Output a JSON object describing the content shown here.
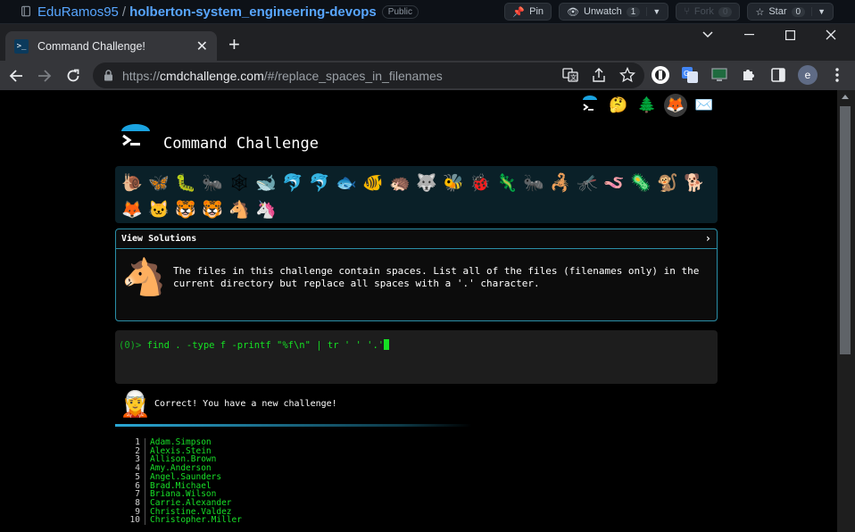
{
  "github": {
    "owner": "EduRamos95",
    "separator": "/",
    "repo": "holberton-system_engineering-devops",
    "visibility": "Public",
    "buttons": [
      {
        "label": "Pin",
        "icon": "pin-icon"
      },
      {
        "label": "Unwatch",
        "count": "1",
        "icon": "eye-icon"
      },
      {
        "label": "Fork",
        "count": "0",
        "icon": "fork-icon"
      },
      {
        "label": "Star",
        "count": "0",
        "icon": "star-icon"
      }
    ]
  },
  "browser": {
    "tab_title": "Command Challenge!",
    "url_scheme": "https://",
    "url_host": "cmdchallenge.com",
    "url_rest": "/#/replace_spaces_in_filenames",
    "profile_initial": "e"
  },
  "page": {
    "site_title": "Command Challenge",
    "level_icons": [
      "🐌",
      "🦋",
      "🐛",
      "🐜",
      "🕸",
      "🐋",
      "🐬",
      "🐬",
      "🐟",
      "🐠",
      "🦔",
      "🐺",
      "🐝",
      "🐞",
      "🦎",
      "🐜",
      "🦂",
      "🦟",
      "🪱",
      "🦠",
      "🐒",
      "🐕",
      "🦊",
      "🐱",
      "🐯",
      "🐯",
      "🐴",
      "🦄"
    ],
    "view_solutions_label": "View Solutions",
    "challenge_text": "The files in this challenge contain spaces. List all of the files (filenames only) in the current directory but replace all spaces with a '.' character.",
    "prompt": "(0)>",
    "command": "find . -type f -printf \"%f\\n\" | tr ' ' '.'",
    "result_message": "Correct! You have a new challenge!",
    "output": [
      {
        "n": "1",
        "name": "Adam.Simpson"
      },
      {
        "n": "2",
        "name": "Alexis.Stein"
      },
      {
        "n": "3",
        "name": "Allison.Brown"
      },
      {
        "n": "4",
        "name": "Amy.Anderson"
      },
      {
        "n": "5",
        "name": "Angel.Saunders"
      },
      {
        "n": "6",
        "name": "Brad.Michael"
      },
      {
        "n": "7",
        "name": "Briana.Wilson"
      },
      {
        "n": "8",
        "name": "Carrie.Alexander"
      },
      {
        "n": "9",
        "name": "Christine.Valdez"
      },
      {
        "n": "10",
        "name": "Christopher.Miller"
      }
    ]
  },
  "colors": {
    "terminal_green": "#15e023",
    "accent_cyan": "#2a8fa8",
    "level_bar_bg": "#0a2028"
  }
}
